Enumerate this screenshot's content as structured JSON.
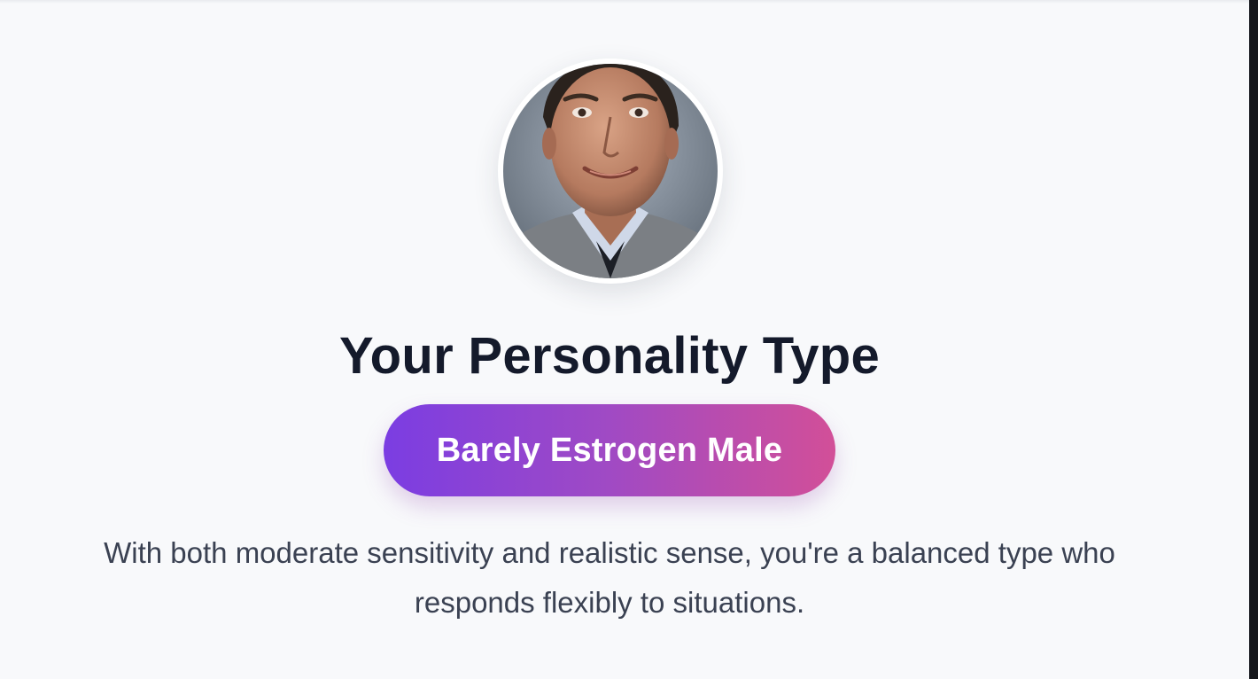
{
  "result": {
    "heading": "Your Personality Type",
    "type_label": "Barely Estrogen Male",
    "description_line1": "With both moderate sensitivity and realistic sense, you're a balanced type who",
    "description_line2": "responds flexibly to situations."
  },
  "avatar": {
    "icon": "portrait-photo"
  },
  "colors": {
    "background": "#f8f9fb",
    "heading": "#141a2b",
    "description": "#3a4152",
    "pill_gradient_start": "#7b3de2",
    "pill_gradient_end": "#d24f98"
  }
}
